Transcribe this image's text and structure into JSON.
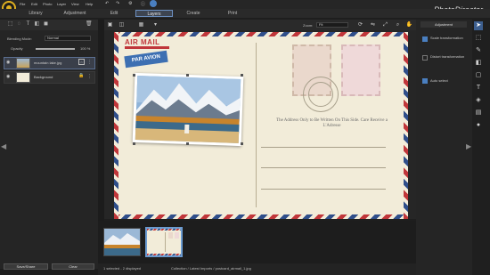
{
  "app": {
    "name": "PhotoDirector",
    "menu": [
      "File",
      "Edit",
      "Photo",
      "Layer",
      "View",
      "Help"
    ]
  },
  "tabs": [
    {
      "label": "Library"
    },
    {
      "label": "Adjustment"
    },
    {
      "label": "Edit"
    },
    {
      "label": "Layers",
      "active": true
    },
    {
      "label": "Create"
    },
    {
      "label": "Print"
    }
  ],
  "layers_panel": {
    "blending_label": "Blending Mode:",
    "blending_value": "Normal",
    "opacity_label": "Opacity",
    "opacity_value": "100 %",
    "layers": [
      {
        "name": "mountain lake.jpg",
        "selected": true
      },
      {
        "name": "Background",
        "selected": false
      }
    ],
    "save_label": "Save/Share",
    "clear_label": "Clear"
  },
  "toolbar": {
    "zoom_label": "Zoom:",
    "zoom_value": "Fit"
  },
  "postcard": {
    "air_mail": "AIR MAIL",
    "par_avion": "PAR AVION",
    "address_text": "The Address Only to Be Written On This Side. Care Receive a L'Adresse"
  },
  "statusbar": {
    "selection": "1 selected - 2 displayed",
    "path": "Collection / Latest Imports / postcard_airmail_1.jpg"
  },
  "adjustment_panel": {
    "header": "Adjustment",
    "options": [
      {
        "label": "Scale transformation",
        "checked": true
      },
      {
        "label": "Distort transformation",
        "checked": false
      }
    ],
    "auto_select_label": "Auto select",
    "auto_select_checked": true
  },
  "colors": {
    "accent": "#6c8fc0",
    "logo": "#e0b020",
    "stripe_red": "#c0363a",
    "stripe_blue": "#2f4e8a"
  }
}
